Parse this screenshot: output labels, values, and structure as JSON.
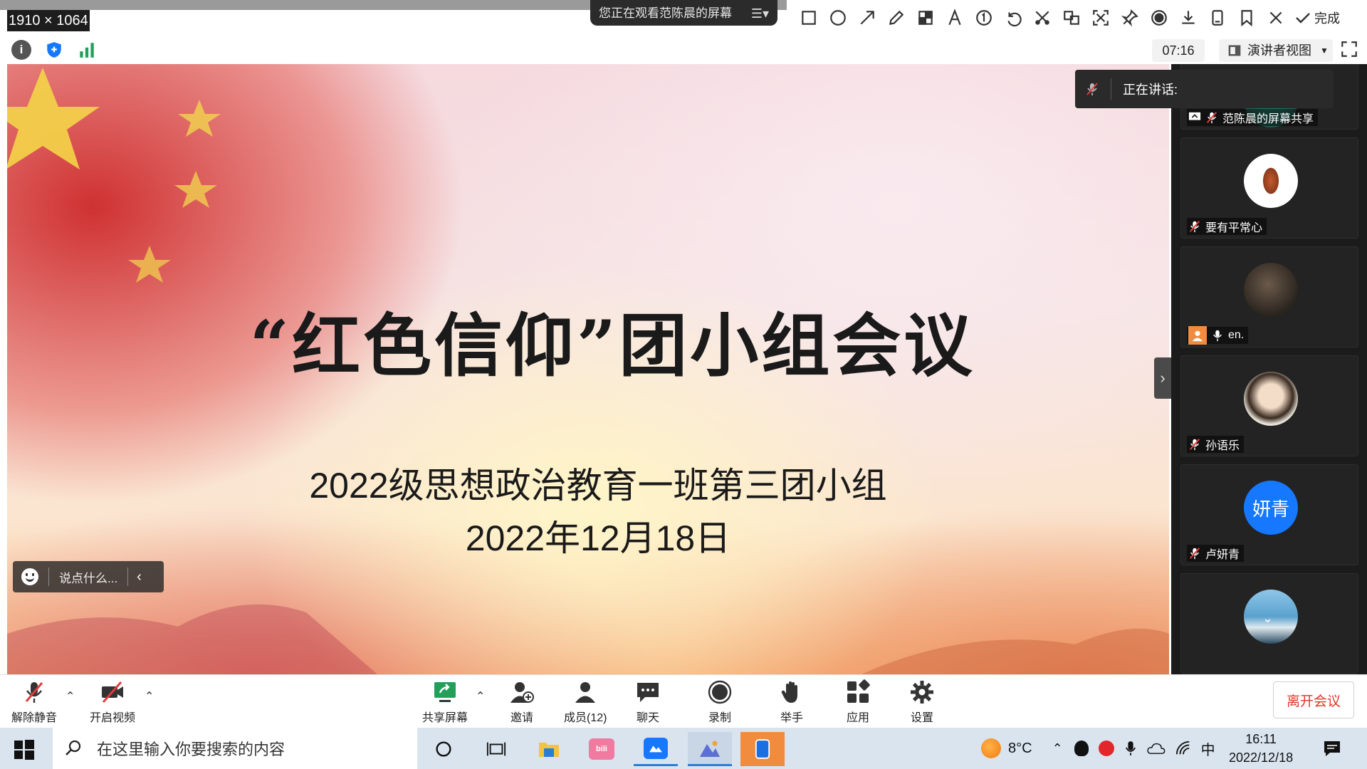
{
  "snip": {
    "dimensions_label": "1910 × 1064",
    "done_label": "完成",
    "tools": [
      "rectangle-icon",
      "ellipse-icon",
      "arrow-icon",
      "pen-icon",
      "mosaic-icon",
      "text-icon",
      "number-icon",
      "undo-icon",
      "crop-icon",
      "translate-icon",
      "scan-icon",
      "pin-icon",
      "record-icon",
      "download-icon",
      "save-icon",
      "bookmark-icon",
      "close-icon"
    ]
  },
  "meeting": {
    "banner": "您正在观看范陈晨的屏幕",
    "timer": "07:16",
    "view_label": "演讲者视图",
    "speaking_label": "正在讲话:",
    "chat_placeholder": "说点什么..."
  },
  "slide": {
    "title": "“红色信仰”团小组会议",
    "subtitle": "2022级思想政治教育一班第三团小组",
    "date": "2022年12月18日"
  },
  "participants": [
    {
      "name": "范陈晨的屏幕共享"
    },
    {
      "name": "要有平常心"
    },
    {
      "name": "en."
    },
    {
      "name": "孙语乐"
    },
    {
      "name": "卢妍青",
      "avatar_text": "妍青"
    },
    {
      "name": ""
    }
  ],
  "toolbar": {
    "unmute": "解除静音",
    "video": "开启视频",
    "share": "共享屏幕",
    "invite": "邀请",
    "members": "成员(12)",
    "chat": "聊天",
    "record": "录制",
    "raise_hand": "举手",
    "apps": "应用",
    "settings": "设置",
    "leave": "离开会议"
  },
  "taskbar": {
    "search_placeholder": "在这里输入你要搜索的内容",
    "weather": "8°C",
    "ime": "中",
    "time": "16:11",
    "date": "2022/12/18"
  },
  "colors": {
    "leave_red": "#e0352b",
    "avatar_blue": "#1677ff",
    "active_app": "#f18c3e",
    "share_green": "#22a05a"
  }
}
